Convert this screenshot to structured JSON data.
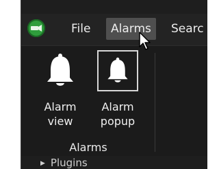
{
  "menubar": {
    "items": [
      {
        "label": "File"
      },
      {
        "label": "Alarms"
      },
      {
        "label": "Searc"
      }
    ]
  },
  "ribbon": {
    "buttons": [
      {
        "label": "Alarm\nview",
        "icon": "bell-icon"
      },
      {
        "label": "Alarm\npopup",
        "icon": "bell-popup-icon"
      }
    ],
    "group_label": "Alarms"
  },
  "tree": {
    "item_label": "Plugins",
    "icon": "triangle-right-icon"
  },
  "colors": {
    "app_icon": "#2f9e3c",
    "menu_highlight": "#4f4f4f",
    "background": "#1e1e1e"
  }
}
